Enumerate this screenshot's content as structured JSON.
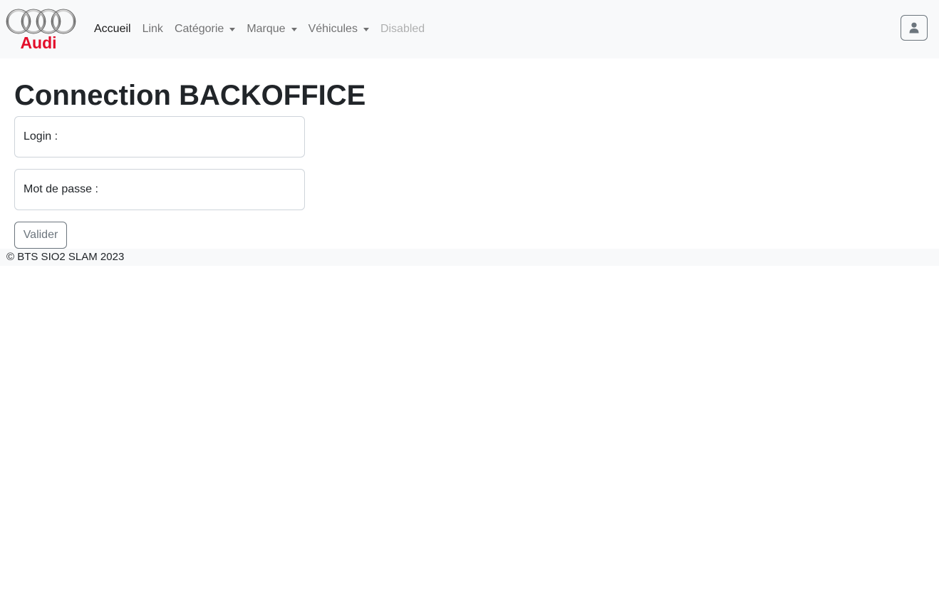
{
  "brand": {
    "logo_text": "Audi",
    "logo_color": "#e30d2a"
  },
  "nav": {
    "items": [
      {
        "label": "Accueil"
      },
      {
        "label": "Link"
      },
      {
        "label": "Catégorie"
      },
      {
        "label": "Marque"
      },
      {
        "label": "Véhicules"
      },
      {
        "label": "Disabled"
      }
    ],
    "user_icon": "person-icon"
  },
  "main": {
    "title": "Connection BACKOFFICE",
    "login_label": "Login :",
    "password_label": "Mot de passe :",
    "submit_label": "Valider"
  },
  "footer": {
    "text": "© BTS SIO2 SLAM 2023"
  },
  "colors": {
    "navbar_bg": "#f8f9fa",
    "text": "#212529",
    "secondary": "#6c757d",
    "border": "#ced4da"
  }
}
